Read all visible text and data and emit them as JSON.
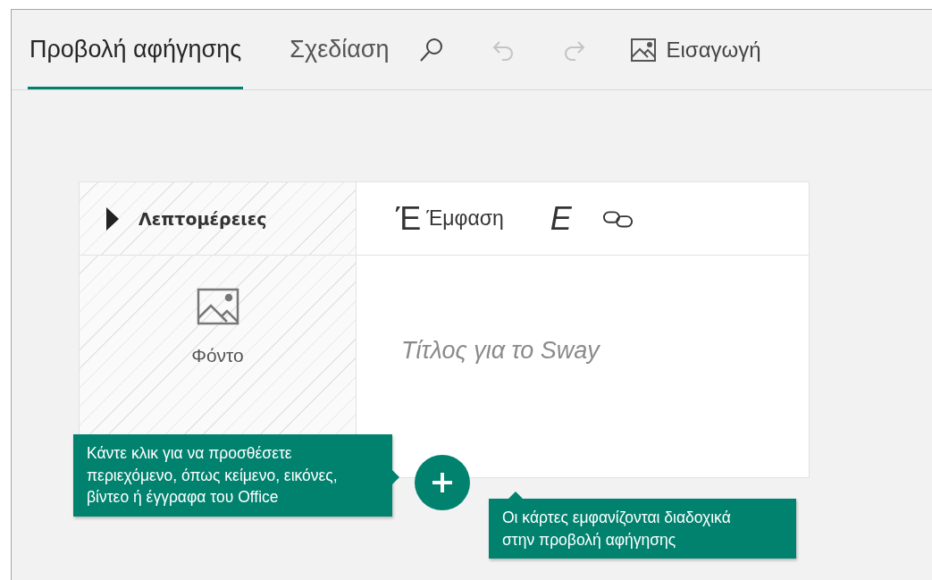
{
  "tabs": [
    {
      "label": "Προβολή αφήγησης",
      "selected": true
    },
    {
      "label": "Σχεδίαση",
      "selected": false
    }
  ],
  "toolbar": {
    "undo_disabled": true,
    "redo_disabled": true,
    "insert_label": "Εισαγωγή"
  },
  "card": {
    "details_label": "Λεπτομέρειες",
    "emphasis_glyph": "Έ",
    "emphasis_label": "Έμφαση",
    "italic_glyph": "E",
    "background_label": "Φόντο",
    "title_placeholder": "Τίτλος για το Sway"
  },
  "tooltips": [
    {
      "text": "Κάντε κλικ για να προσθέσετε περιεχόμενο, όπως κείμενο, εικόνες, βίντεο ή έγγραφα του Office"
    },
    {
      "text": "Οι κάρτες εμφανίζονται διαδοχικά στην προβολή αφήγησης"
    }
  ]
}
